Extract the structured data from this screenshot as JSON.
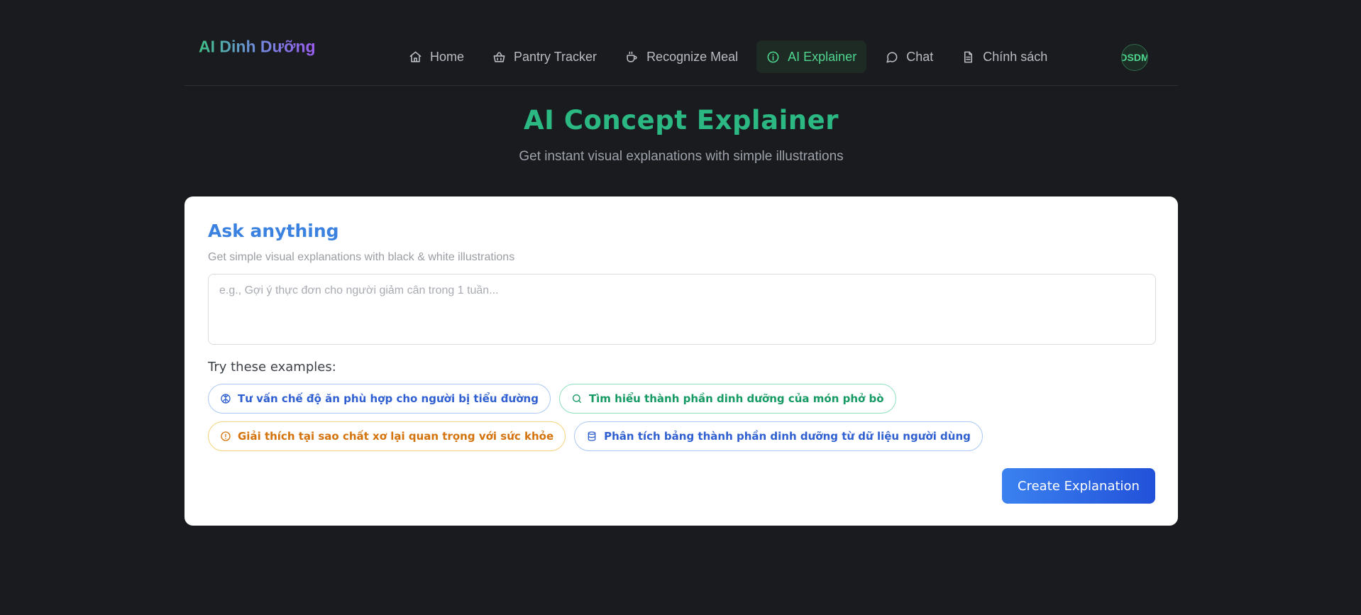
{
  "nav": {
    "logo": "AI Dinh Dưỡng",
    "items": [
      {
        "label": "Home",
        "icon": "home-icon"
      },
      {
        "label": "Pantry Tracker",
        "icon": "basket-icon"
      },
      {
        "label": "Recognize Meal",
        "icon": "cup-icon"
      },
      {
        "label": "AI Explainer",
        "icon": "info-icon",
        "active": true
      },
      {
        "label": "Chat",
        "icon": "chat-bubble-icon"
      },
      {
        "label": "Chính sách",
        "icon": "document-icon"
      }
    ],
    "avatar_text": "DSDM"
  },
  "hero": {
    "title": "AI Concept Explainer",
    "subtitle": "Get instant visual explanations with simple illustrations"
  },
  "card": {
    "title": "Ask anything",
    "subtitle": "Get simple visual explanations with black & white illustrations",
    "prompt_placeholder": "e.g., Gợi ý thực đơn cho người giảm cân trong 1 tuần...",
    "examples_label": "Try these examples:",
    "examples": [
      {
        "label": "Tư vấn chế độ ăn phù hợp cho người bị tiểu đường",
        "icon": "brain-icon",
        "color": "blue"
      },
      {
        "label": "Tìm hiểu thành phần dinh dưỡng của món phở bò",
        "icon": "search-icon",
        "color": "green"
      },
      {
        "label": "Giải thích tại sao chất xơ lại quan trọng với sức khỏe",
        "icon": "info-icon",
        "color": "orange"
      },
      {
        "label": "Phân tích bảng thành phần dinh dưỡng từ dữ liệu người dùng",
        "icon": "database-icon",
        "color": "blue"
      }
    ],
    "submit_label": "Create Explanation"
  },
  "colors": {
    "background": "#1a1b1f",
    "accent_green": "#4fd68f",
    "title_green": "#2bb883",
    "accent_blue": "#3b82e0",
    "chip_orange": "#d4730b"
  }
}
